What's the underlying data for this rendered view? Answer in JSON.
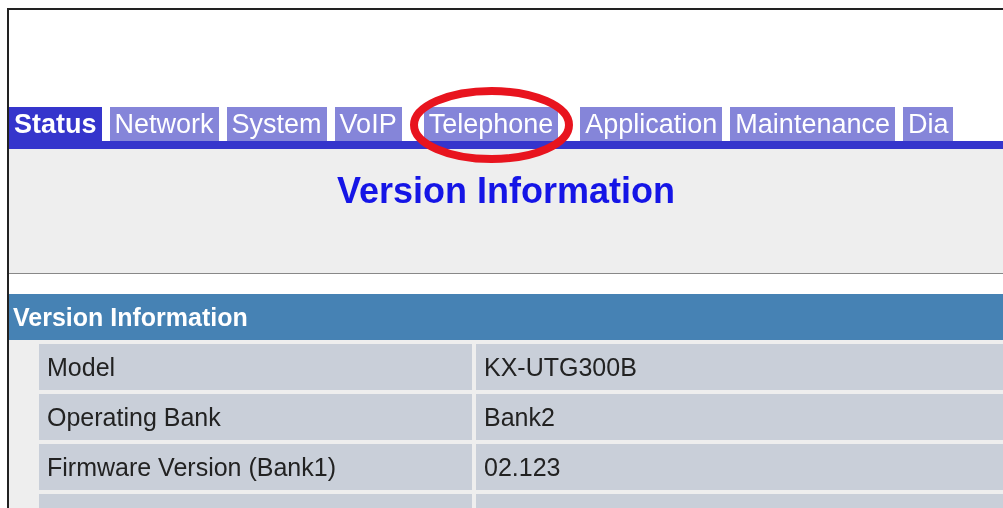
{
  "tabs": [
    {
      "label": "Status",
      "selected": true
    },
    {
      "label": "Network",
      "selected": false
    },
    {
      "label": "System",
      "selected": false
    },
    {
      "label": "VoIP",
      "selected": false
    },
    {
      "label": "Telephone",
      "selected": false
    },
    {
      "label": "Application",
      "selected": false
    },
    {
      "label": "Maintenance",
      "selected": false
    },
    {
      "label": "Dia",
      "selected": false
    }
  ],
  "page_title": "Version Information",
  "section": {
    "title": "Version Information",
    "rows": [
      {
        "label": "Model",
        "value": "KX-UTG300B"
      },
      {
        "label": "Operating Bank",
        "value": "Bank2"
      },
      {
        "label": "Firmware Version (Bank1)",
        "value": "02.123"
      },
      {}
    ]
  }
}
